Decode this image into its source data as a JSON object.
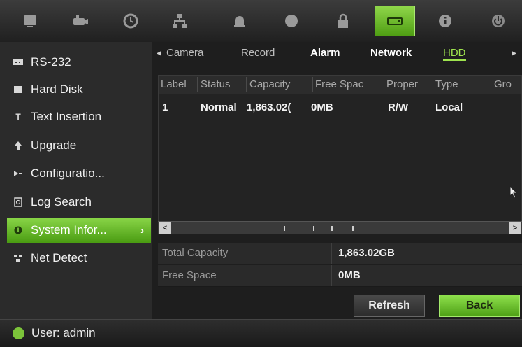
{
  "toolbar": {
    "icons": [
      "live-view-icon",
      "camera-icon",
      "playback-icon",
      "network-icon",
      "alarm-icon",
      "record-icon",
      "lock-icon",
      "hdd-icon",
      "info-icon",
      "power-icon"
    ],
    "active_index": 7,
    "accent_color": "#6cc22c"
  },
  "sidebar": {
    "items": [
      {
        "label": "RS-232",
        "icon": "rs232-icon"
      },
      {
        "label": "Hard Disk",
        "icon": "hard-disk-icon"
      },
      {
        "label": "Text Insertion",
        "icon": "text-insertion-icon"
      },
      {
        "label": "Upgrade",
        "icon": "upgrade-icon"
      },
      {
        "label": "Configuratio...",
        "icon": "configuration-icon"
      },
      {
        "label": "Log Search",
        "icon": "log-search-icon"
      },
      {
        "label": "System Infor...",
        "icon": "info-icon",
        "active": true,
        "arrow": "›"
      },
      {
        "label": "Net Detect",
        "icon": "net-detect-icon"
      }
    ]
  },
  "tabs": {
    "left_arrow": "◂",
    "right_arrow": "▸",
    "items": [
      {
        "label": "Camera"
      },
      {
        "label": "Record"
      },
      {
        "label": "Alarm"
      },
      {
        "label": "Network"
      },
      {
        "label": "HDD"
      }
    ]
  },
  "table": {
    "headers": [
      "Label",
      "Status",
      "Capacity",
      "Free Spac",
      "Proper",
      "Type",
      "Gro"
    ],
    "rows": [
      [
        "1",
        "Normal",
        "1,863.02(",
        "0MB",
        "R/W",
        "Local",
        ""
      ]
    ]
  },
  "scrollbar": {
    "left": "<",
    "right": ">"
  },
  "summary": {
    "total_capacity_label": "Total Capacity",
    "total_capacity_value": "1,863.02GB",
    "free_space_label": "Free Space",
    "free_space_value": "0MB"
  },
  "buttons": {
    "refresh": "Refresh",
    "back": "Back"
  },
  "status": {
    "user": "User: admin"
  }
}
